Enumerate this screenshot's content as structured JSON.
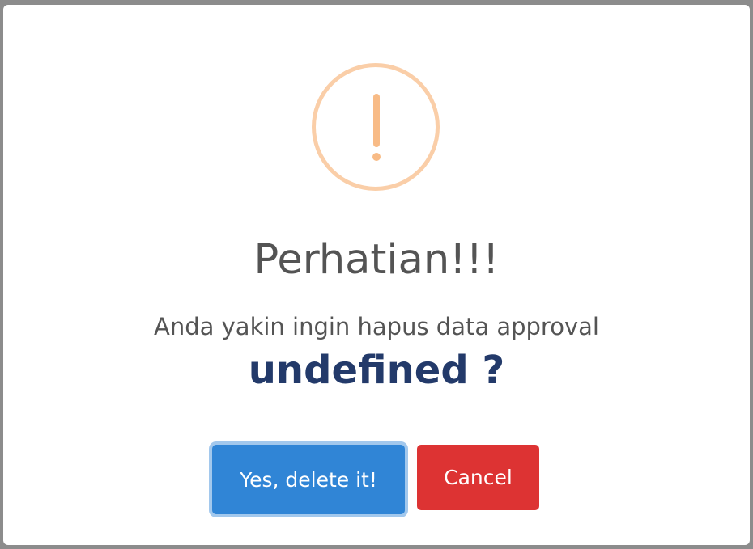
{
  "dialog": {
    "title": "Perhatian!!!",
    "message": "Anda yakin ingin hapus data approval",
    "subject": "undefined ?",
    "icon": "warning-icon",
    "confirm_label": "Yes, delete it!",
    "cancel_label": "Cancel"
  },
  "colors": {
    "confirm": "#3085d6",
    "cancel": "#dd3333",
    "icon_border": "#facea8",
    "icon_mark": "#f8bb86",
    "subject_text": "#233a6a",
    "body_text": "#545454"
  }
}
